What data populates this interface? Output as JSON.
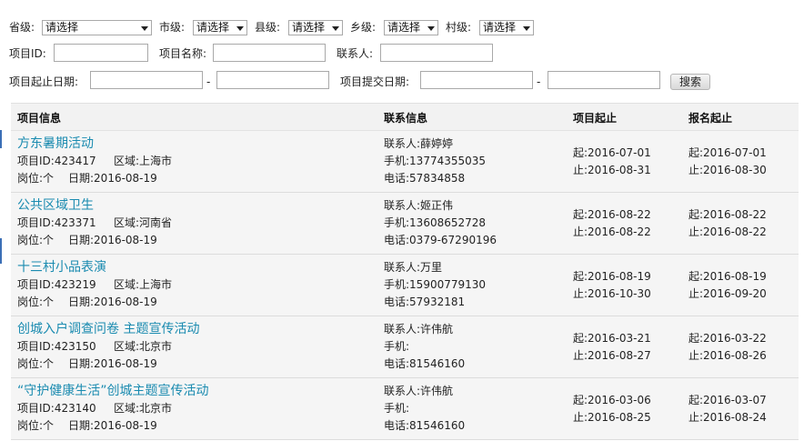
{
  "filters": {
    "province_label": "省级:",
    "province_value": "请选择",
    "city_label": "市级:",
    "city_value": "请选择",
    "county_label": "县级:",
    "county_value": "请选择",
    "town_label": "乡级:",
    "town_value": "请选择",
    "village_label": "村级:",
    "village_value": "请选择",
    "project_id_label": "项目ID:",
    "project_name_label": "项目名称:",
    "contact_label": "联系人:",
    "project_date_label": "项目起止日期:",
    "submit_date_label": "项目提交日期:",
    "dash": "-",
    "search_button": "搜索"
  },
  "table": {
    "headers": {
      "info": "项目信息",
      "contact": "联系信息",
      "project_period": "项目起止",
      "signup_period": "报名起止"
    },
    "labels": {
      "id": "项目ID:",
      "region": "区域:",
      "position": "岗位:个",
      "date": "日期:",
      "contact": "联系人:",
      "mobile": "手机:",
      "phone": "电话:",
      "start": "起:",
      "end": "止:"
    },
    "rows": [
      {
        "title": "方东暑期活动",
        "id": "423417",
        "region": "上海市",
        "date": "2016-08-19",
        "contact": "薛婷婷",
        "mobile": "13774355035",
        "phone": "57834858",
        "project_start": "2016-07-01",
        "project_end": "2016-08-31",
        "signup_start": "2016-07-01",
        "signup_end": "2016-08-30"
      },
      {
        "title": "公共区域卫生",
        "id": "423371",
        "region": "河南省",
        "date": "2016-08-19",
        "contact": "姬正伟",
        "mobile": "13608652728",
        "phone": "0379-67290196",
        "project_start": "2016-08-22",
        "project_end": "2016-08-22",
        "signup_start": "2016-08-22",
        "signup_end": "2016-08-22"
      },
      {
        "title": "十三村小品表演",
        "id": "423219",
        "region": "上海市",
        "date": "2016-08-19",
        "contact": "万里",
        "mobile": "15900779130",
        "phone": "57932181",
        "project_start": "2016-08-19",
        "project_end": "2016-10-30",
        "signup_start": "2016-08-19",
        "signup_end": "2016-09-20"
      },
      {
        "title": "创城入户调查问卷 主题宣传活动",
        "id": "423150",
        "region": "北京市",
        "date": "2016-08-19",
        "contact": "许伟航",
        "mobile": "",
        "phone": "81546160",
        "project_start": "2016-03-21",
        "project_end": "2016-08-27",
        "signup_start": "2016-03-22",
        "signup_end": "2016-08-26"
      },
      {
        "title": "“守护健康生活”创城主题宣传活动",
        "id": "423140",
        "region": "北京市",
        "date": "2016-08-19",
        "contact": "许伟航",
        "mobile": "",
        "phone": "81546160",
        "project_start": "2016-03-06",
        "project_end": "2016-08-25",
        "signup_start": "2016-03-07",
        "signup_end": "2016-08-24"
      }
    ]
  }
}
